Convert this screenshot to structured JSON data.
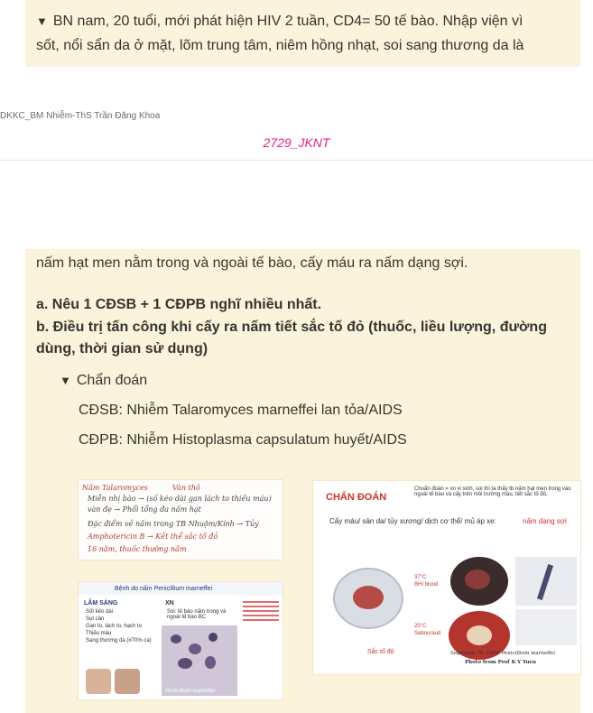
{
  "question_block": {
    "toggle_icon": "triangle-down-icon",
    "line1": "BN nam, 20 tuổi, mới phát hiện HIV 2 tuần, CD4= 50 tế bào. Nhập viện vì",
    "line2": "sốt, nổi sẩn da ở mặt, lõm trung tâm, niêm hồng nhạt, soi sang thương da là"
  },
  "page_footer": {
    "left_text": "DKKC_BM Nhiễm-ThS Trần Đăng Khoa",
    "page_number": "2729_JKNT"
  },
  "continued_block": {
    "line3": "nấm hạt men nằm trong và ngoài tế bào, cấy máu ra nấm dạng sợi.",
    "question_a": "a. Nêu 1 CĐSB + 1 CĐPB nghĩ nhiều nhất.",
    "question_b_line1": "b. Điều trị tấn công khi cấy ra nấm tiết sắc tố đỏ (thuốc, liều lượng, đường",
    "question_b_line2": "dùng, thời gian sử dụng)",
    "toggle_title": "Chẩn đoán",
    "cdsb": "CĐSB: Nhiễm Talaromyces marneffei lan tỏa/AIDS",
    "cdpb": "CĐPB: Nhiễm Histoplasma capsulatum huyết/AIDS"
  },
  "image_notes": {
    "title": "Nấm Talaromyces",
    "right_label": "Vàn thô",
    "row1": "Miễn nhị bào → (số kéo dài gan lách to thiếu máu)",
    "row2": "vàn đẹ → Phổi tổng đa nấm hạt",
    "row3": "Đặc điểm về nấm trong TB Nhuộm/Kính  → Tủy",
    "row4": "Amphotericin B   → Kết thể sắc tố đỏ",
    "row5": "16 năm, thuốc thường nấm"
  },
  "image_slide1": {
    "title": "Bệnh do nấm Penicillium marneffei",
    "section_left": "LÂM SÀNG",
    "items": [
      "Sốt kéo dài",
      "Sụt cân",
      "Gan to, lách to, hạch to",
      "Thiếu máu",
      "Sang thương da (#70% ca)"
    ],
    "section_mid": "XN",
    "mid_text": "Soi: tế bào nấm trong và ngoài tế bào BC",
    "caption": "Penicillium marneffei"
  },
  "image_slide2": {
    "title": "CHẨN ĐOÁN",
    "header_text": "Chuẩn đoán = xn vi sinh, soi thì ta thấy tb nấm hạt men trong vào ngoài tế bào và cấy trên môi trường máu, tiết sắc tố đỏ,",
    "subtitle": "Cấy máu/ sản da/ tủy xương/ dịch cơ thể/ mủ áp xe:",
    "subtitle_highlight": "nấm dạng sợi",
    "temp1": "37°C",
    "medium1": "BHI blood",
    "temp2": "25°C",
    "medium2": "Sabouraud",
    "pigment_label": "Sắc tố đỏ",
    "credit1": "Segretain, IP, 1959: Penicillium marneffei",
    "credit2": "Photo from Prof K Y Yuen"
  },
  "colors": {
    "callout_bg": "#fbf3db",
    "page_number": "#e0218a",
    "slide_title_red": "#d0312d"
  }
}
